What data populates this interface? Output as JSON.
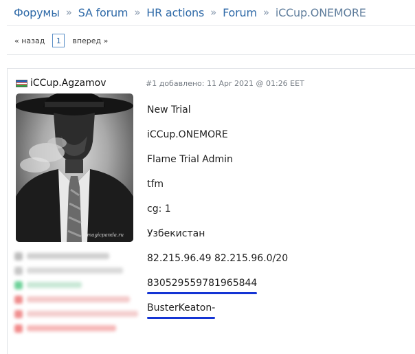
{
  "breadcrumb": {
    "items": [
      "Форумы",
      "SA forum",
      "HR actions",
      "Forum"
    ],
    "current": "iCCup.ONEMORE",
    "separator": "»"
  },
  "pager": {
    "prev_label": "« назад",
    "current_page": "1",
    "next_label": "вперед »"
  },
  "post": {
    "author": "iCCup.Agzamov",
    "flag_icon": "uzbekistan-flag-icon",
    "meta": "#1 добавлено: 11 Apr 2021 @ 01:26 EET",
    "lines": [
      "New Trial",
      "iCCup.ONEMORE",
      "Flame Trial Admin",
      "tfm",
      "cg: 1",
      "Узбекистан",
      "82.215.96.49 82.215.96.0/20",
      "830529559781965844",
      "BusterKeaton-"
    ],
    "underline_color": "#1434d4",
    "avatar_watermark": "magicpanda.ru",
    "avatar_alt_icon": "man-in-hat-smoking-icon"
  },
  "colors": {
    "link": "#2f6aa8",
    "current_crumb": "#5f7d9c",
    "meta_text": "#737a82"
  }
}
